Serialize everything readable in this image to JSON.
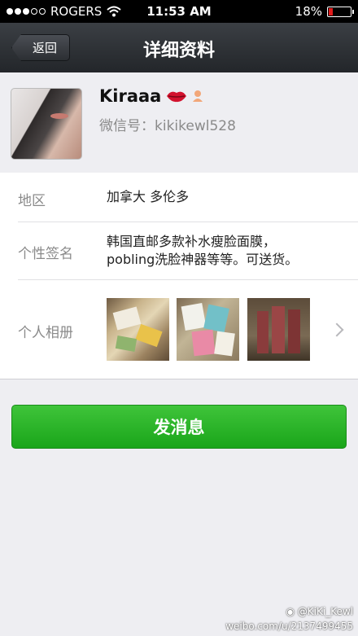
{
  "status_bar": {
    "carrier": "ROGERS",
    "time": "11:53 AM",
    "battery": "18%",
    "battery_level": 0.18
  },
  "nav": {
    "back_label": "返回",
    "title": "详细资料"
  },
  "profile": {
    "name": "Kiraaa",
    "wechat_id": "微信号：kikikewl528",
    "icons": [
      "kiss-lips-icon",
      "female-gender-icon"
    ]
  },
  "info": {
    "region_label": "地区",
    "region_value": "加拿大 多伦多",
    "signature_label": "个性签名",
    "signature_line1": "韩国直邮多款补水瘦脸面膜，",
    "signature_line2": "pobling洗脸神器等等。可送货。",
    "album_label": "个人相册"
  },
  "actions": {
    "send_message": "发消息"
  },
  "watermark": {
    "handle": "@KiKi_Kewl",
    "url": "weibo.com/u/2137499455"
  },
  "colors": {
    "accent_green": "#1aa51a",
    "nav_dark": "#2b2e33",
    "battery_red": "#e21b1b"
  }
}
